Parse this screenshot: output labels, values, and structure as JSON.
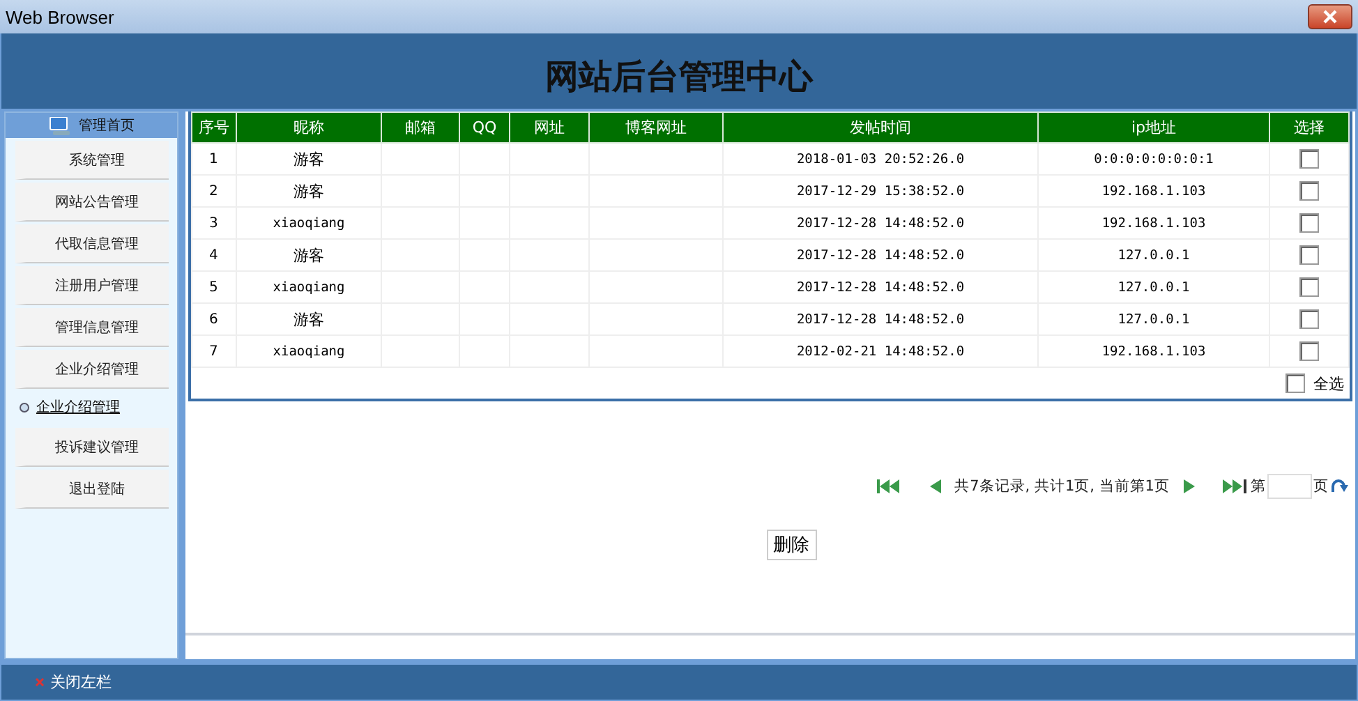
{
  "window": {
    "title": "Web Browser"
  },
  "header": {
    "title": "网站后台管理中心"
  },
  "sidebar": {
    "home": "管理首页",
    "items": [
      {
        "label": "系统管理",
        "selected": false
      },
      {
        "label": "网站公告管理",
        "selected": false
      },
      {
        "label": "代取信息管理",
        "selected": false
      },
      {
        "label": "注册用户管理",
        "selected": false
      },
      {
        "label": "管理信息管理",
        "selected": false
      },
      {
        "label": "企业介绍管理",
        "selected": false
      },
      {
        "label": "企业介绍管理",
        "selected": true
      },
      {
        "label": "投诉建议管理",
        "selected": false
      },
      {
        "label": "退出登陆",
        "selected": false
      }
    ]
  },
  "table": {
    "columns": [
      "序号",
      "昵称",
      "邮箱",
      "QQ",
      "网址",
      "博客网址",
      "发帖时间",
      "ip地址",
      "选择"
    ],
    "rows": [
      {
        "no": "1",
        "nickname": "游客",
        "time": "2018-01-03 20:52:26.0",
        "ip": "0:0:0:0:0:0:0:1",
        "checked": false
      },
      {
        "no": "2",
        "nickname": "游客",
        "time": "2017-12-29 15:38:52.0",
        "ip": "192.168.1.103",
        "checked": false
      },
      {
        "no": "3",
        "nickname": "xiaoqiang",
        "time": "2017-12-28 14:48:52.0",
        "ip": "192.168.1.103",
        "checked": false
      },
      {
        "no": "4",
        "nickname": "游客",
        "time": "2017-12-28 14:48:52.0",
        "ip": "127.0.0.1",
        "checked": false
      },
      {
        "no": "5",
        "nickname": "xiaoqiang",
        "time": "2017-12-28 14:48:52.0",
        "ip": "127.0.0.1",
        "checked": false
      },
      {
        "no": "6",
        "nickname": "游客",
        "time": "2017-12-28 14:48:52.0",
        "ip": "127.0.0.1",
        "checked": false
      },
      {
        "no": "7",
        "nickname": "xiaoqiang",
        "time": "2012-02-21 14:48:52.0",
        "ip": "192.168.1.103",
        "checked": false
      }
    ],
    "select_all": {
      "label": "全选",
      "checked": false
    }
  },
  "pagination": {
    "summary": "共7条记录, 共计1页, 当前第1页",
    "page_prefix": "第",
    "page_suffix": "页"
  },
  "delete_button": "删除",
  "footer": {
    "close_sidebar": "关闭左栏"
  }
}
